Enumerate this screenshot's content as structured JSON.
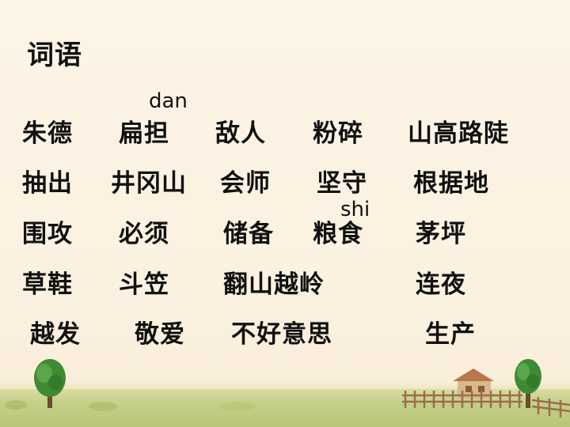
{
  "title": "词语",
  "pinyin": {
    "dan": "dan",
    "shi": "shi"
  },
  "rows": [
    [
      "朱德",
      "扁担",
      "敌人",
      "粉碎",
      "山高路陡"
    ],
    [
      "抽出",
      "井冈山",
      "会师",
      "坚守",
      "根据地"
    ],
    [
      "围攻",
      "必须",
      "储备",
      "粮食",
      "茅坪"
    ],
    [
      "草鞋",
      "斗笠",
      "翻山越岭",
      "连夜"
    ],
    [
      "越发",
      "敬爱",
      "不好意思",
      "生产"
    ]
  ],
  "scenery_colors": {
    "grass": "#c4cf86",
    "tree": "#4e8f3a",
    "fence": "#a7785a",
    "roof": "#c98a52"
  }
}
